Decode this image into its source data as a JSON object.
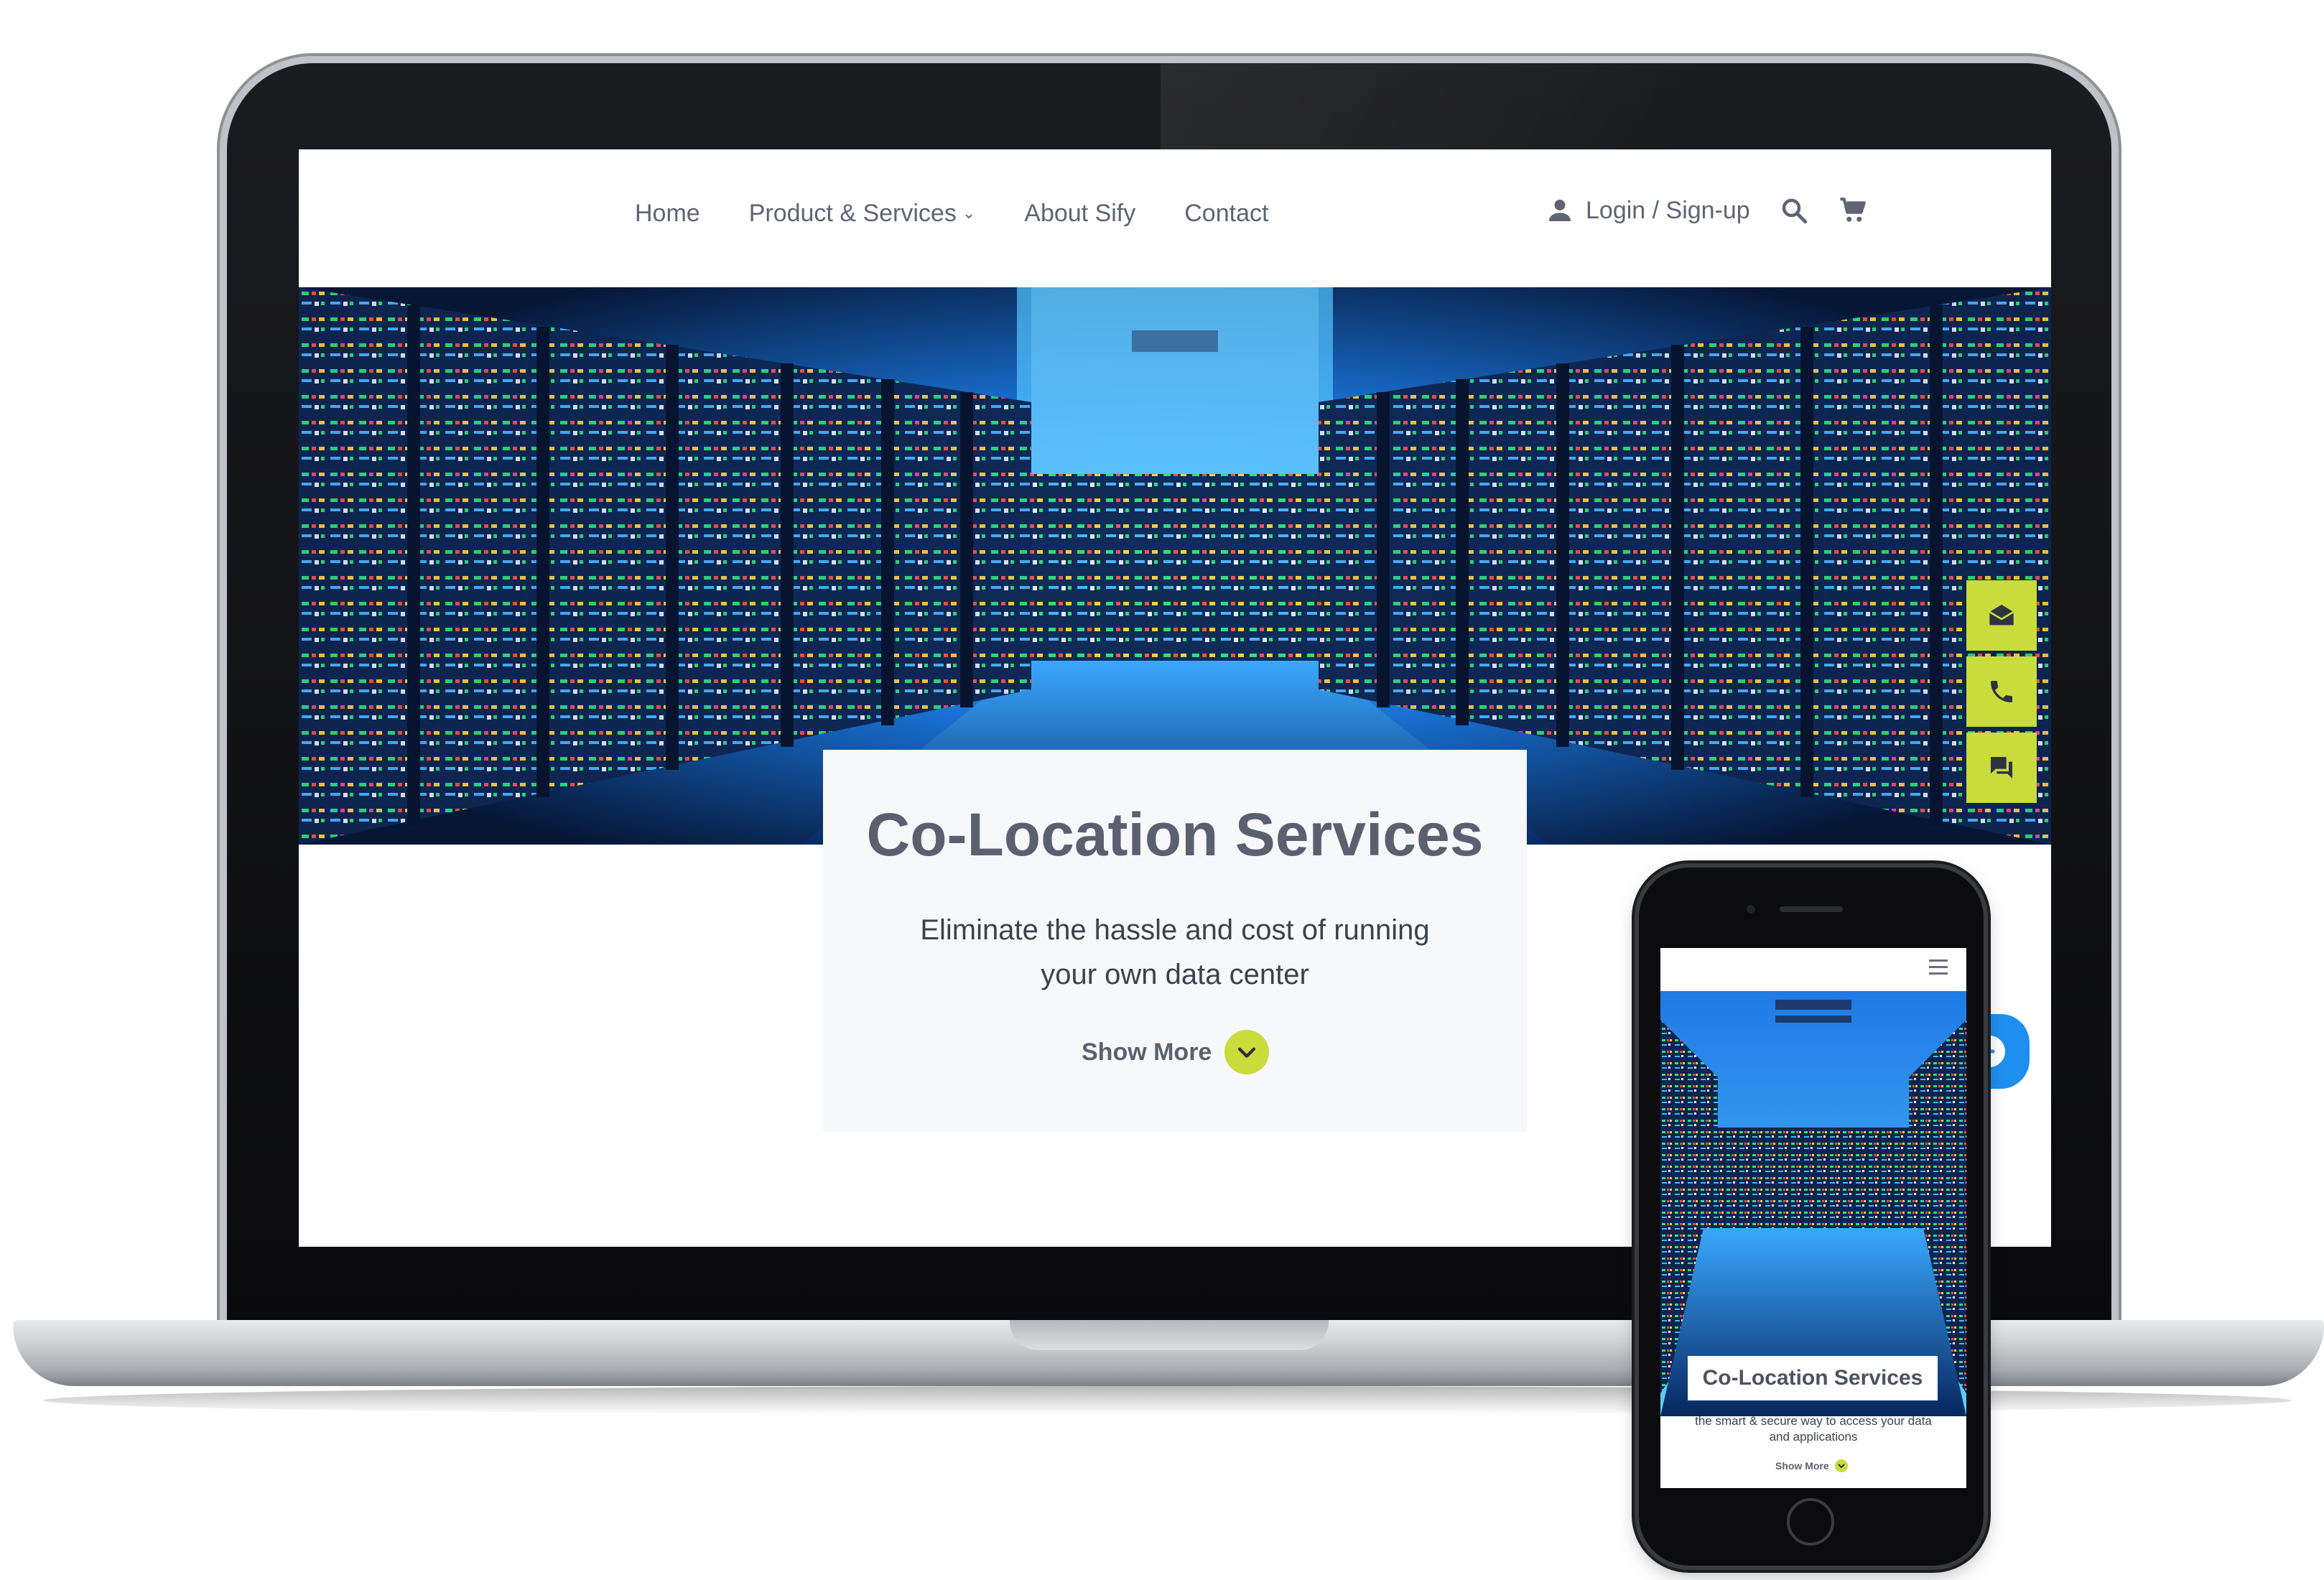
{
  "laptop_site": {
    "nav": {
      "home": "Home",
      "products": "Product & Services",
      "products_chevron": "⌄",
      "about": "About Sify",
      "contact": "Contact"
    },
    "header_right": {
      "login_label": "Login / Sign-up",
      "icons": [
        "user-icon",
        "search-icon",
        "cart-icon"
      ]
    },
    "hero": {
      "title": "Co-Location Services",
      "subtitle": "Eliminate the hassle and cost of running your own data center",
      "show_more": "Show More"
    },
    "side_actions": [
      "email-icon",
      "phone-icon",
      "chat-icon"
    ],
    "accent_color": "#c8dc3c"
  },
  "phone_site": {
    "hero": {
      "title": "Co-Location Services",
      "subtitle": "the smart & secure way to access your data and applications",
      "show_more": "Show More"
    },
    "icons": [
      "hamburger-menu-icon"
    ]
  }
}
